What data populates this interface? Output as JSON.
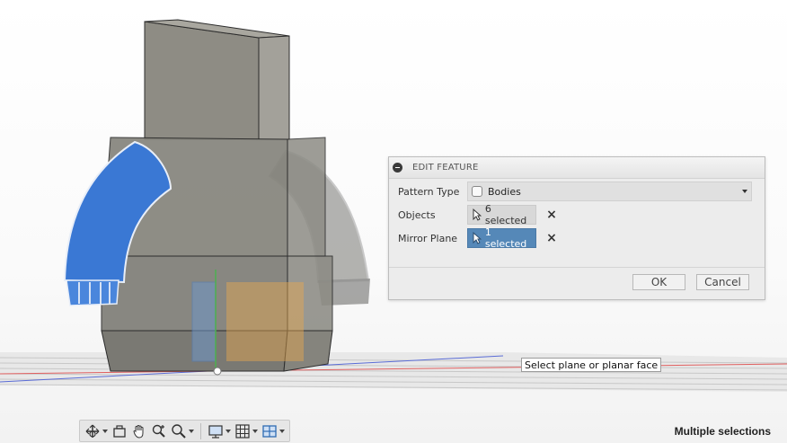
{
  "dialog": {
    "title": "EDIT FEATURE",
    "pattern_type_label": "Pattern Type",
    "pattern_type_value": "Bodies",
    "objects_label": "Objects",
    "objects_value": "6 selected",
    "mirror_plane_label": "Mirror Plane",
    "mirror_plane_value": "1 selected",
    "ok_label": "OK",
    "cancel_label": "Cancel"
  },
  "tooltip": {
    "text": "Select plane or planar face"
  },
  "toolbar": {
    "icons": [
      "orbit-icon",
      "look-at-icon",
      "pan-icon",
      "zoom-icon",
      "fit-icon",
      "display-settings-icon",
      "grid-settings-icon",
      "viewports-icon"
    ]
  },
  "status": {
    "text": "Multiple selections"
  },
  "colors": {
    "selected_body": "#3a78d4",
    "body": "#8e8c84",
    "mirror_plane": "#e9a94e",
    "active_button": "#5588b8"
  }
}
